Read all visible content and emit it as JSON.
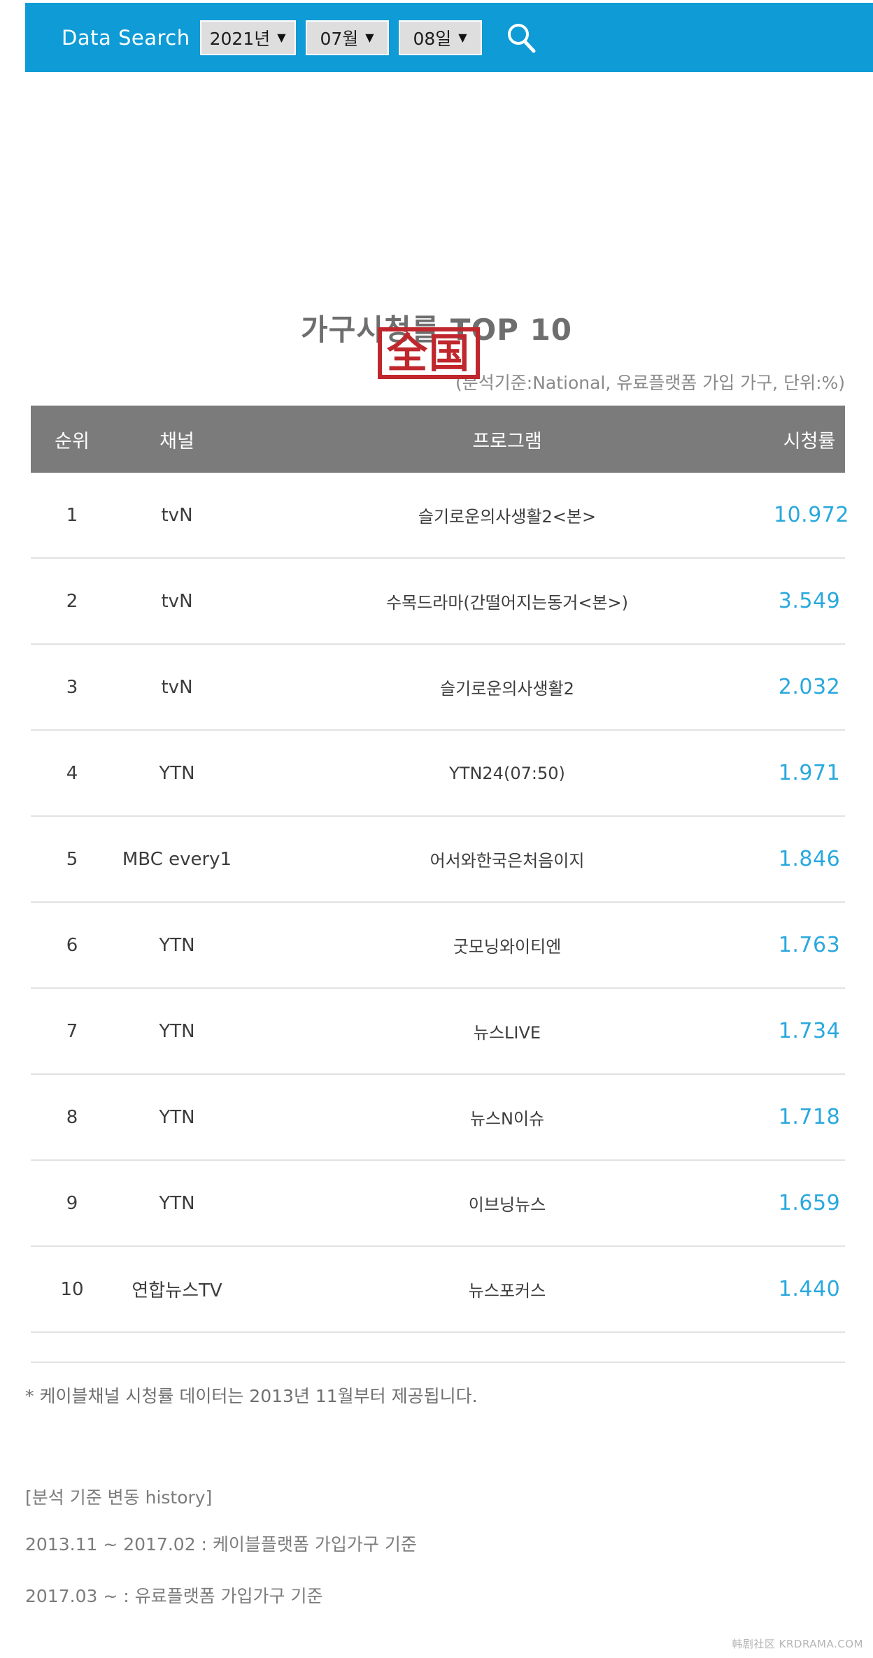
{
  "header": {
    "label": "Data Search",
    "year": {
      "value": "2021년",
      "caret": "▼"
    },
    "month": {
      "value": "07월",
      "caret": "▼"
    },
    "day": {
      "value": "08일",
      "caret": "▼"
    },
    "search_icon": "search-icon",
    "bar_color": "#0e9bd6"
  },
  "title": "가구시청률 TOP 10",
  "subtitle": "(분석기준:National, 유료플랫폼 가입 가구, 단위:%)",
  "stamp": {
    "text": "全国",
    "color": "#c0272d"
  },
  "table": {
    "columns": [
      "순위",
      "채널",
      "프로그램",
      "시청률"
    ],
    "rows": [
      {
        "rank": "1",
        "channel": "tvN",
        "program": "슬기로운의사생활2<본>",
        "rating": "10.972"
      },
      {
        "rank": "2",
        "channel": "tvN",
        "program": "수목드라마(간떨어지는동거<본>)",
        "rating": "3.549"
      },
      {
        "rank": "3",
        "channel": "tvN",
        "program": "슬기로운의사생활2",
        "rating": "2.032"
      },
      {
        "rank": "4",
        "channel": "YTN",
        "program": "YTN24(07:50)",
        "rating": "1.971"
      },
      {
        "rank": "5",
        "channel": "MBC every1",
        "program": "어서와한국은처음이지",
        "rating": "1.846"
      },
      {
        "rank": "6",
        "channel": "YTN",
        "program": "굿모닝와이티엔",
        "rating": "1.763"
      },
      {
        "rank": "7",
        "channel": "YTN",
        "program": "뉴스LIVE",
        "rating": "1.734"
      },
      {
        "rank": "8",
        "channel": "YTN",
        "program": "뉴스N이슈",
        "rating": "1.718"
      },
      {
        "rank": "9",
        "channel": "YTN",
        "program": "이브닝뉴스",
        "rating": "1.659"
      },
      {
        "rank": "10",
        "channel": "연합뉴스TV",
        "program": "뉴스포커스",
        "rating": "1.440"
      }
    ],
    "header_bg": "#7b7b7b",
    "rating_color": "#29a8dd"
  },
  "footnotes": {
    "note": "* 케이블채널 시청률 데이터는 2013년 11월부터 제공됩니다.",
    "history_title": "[분석 기준 변동 history]",
    "history_1": "2013.11 ~ 2017.02 : 케이블플랫폼 가입가구 기준",
    "history_2": "2017.03 ~ : 유료플랫폼 가입가구 기준"
  },
  "site_watermark": "韩剧社区  KRDRAMA.COM",
  "chart_data": {
    "type": "table",
    "title": "가구시청률 TOP 10",
    "subtitle": "(분석기준:National, 유료플랫폼 가입 가구, 단위:%)",
    "columns": [
      "순위",
      "채널",
      "프로그램",
      "시청률"
    ],
    "categories": [
      "슬기로운의사생활2<본>",
      "수목드라마(간떨어지는동거<본>)",
      "슬기로운의사생활2",
      "YTN24(07:50)",
      "어서와한국은처음이지",
      "굿모닝와이티엔",
      "뉴스LIVE",
      "뉴스N이슈",
      "이브닝뉴스",
      "뉴스포커스"
    ],
    "values": [
      10.972,
      3.549,
      2.032,
      1.971,
      1.846,
      1.763,
      1.734,
      1.718,
      1.659,
      1.44
    ],
    "ylabel": "시청률 (%)",
    "xlabel": "프로그램"
  }
}
